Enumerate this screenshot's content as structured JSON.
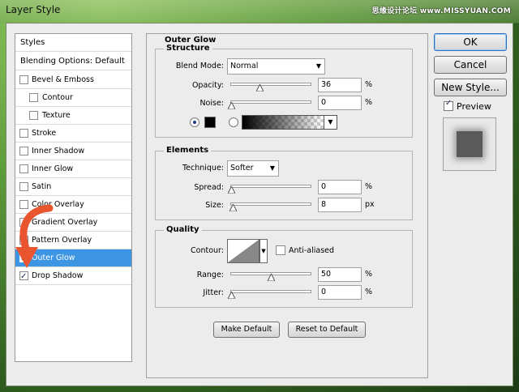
{
  "window": {
    "title": "Layer Style",
    "watermark": "思缘设计论坛 www.MISSYUAN.COM"
  },
  "styles_list": {
    "header": "Styles",
    "blending": "Blending Options: Default",
    "items": [
      {
        "label": "Bevel & Emboss",
        "checked": false,
        "indent": 0
      },
      {
        "label": "Contour",
        "checked": false,
        "indent": 1
      },
      {
        "label": "Texture",
        "checked": false,
        "indent": 1
      },
      {
        "label": "Stroke",
        "checked": false,
        "indent": 0
      },
      {
        "label": "Inner Shadow",
        "checked": false,
        "indent": 0
      },
      {
        "label": "Inner Glow",
        "checked": false,
        "indent": 0
      },
      {
        "label": "Satin",
        "checked": false,
        "indent": 0
      },
      {
        "label": "Color Overlay",
        "checked": false,
        "indent": 0
      },
      {
        "label": "Gradient Overlay",
        "checked": false,
        "indent": 0
      },
      {
        "label": "Pattern Overlay",
        "checked": false,
        "indent": 0
      },
      {
        "label": "Outer Glow",
        "checked": true,
        "indent": 0,
        "selected": true
      },
      {
        "label": "Drop Shadow",
        "checked": true,
        "indent": 0
      }
    ]
  },
  "outer_glow": {
    "title": "Outer Glow",
    "structure": {
      "title": "Structure",
      "blend_mode_label": "Blend Mode:",
      "blend_mode": "Normal",
      "opacity_label": "Opacity:",
      "opacity": "36",
      "opacity_fraction": 0.36,
      "noise_label": "Noise:",
      "noise": "0",
      "noise_fraction": 0.0,
      "percent": "%"
    },
    "elements": {
      "title": "Elements",
      "technique_label": "Technique:",
      "technique": "Softer",
      "spread_label": "Spread:",
      "spread": "0",
      "spread_fraction": 0.0,
      "size_label": "Size:",
      "size": "8",
      "size_fraction": 0.03,
      "percent": "%",
      "px": "px"
    },
    "quality": {
      "title": "Quality",
      "contour_label": "Contour:",
      "anti_aliased": "Anti-aliased",
      "range_label": "Range:",
      "range": "50",
      "range_fraction": 0.5,
      "jitter_label": "Jitter:",
      "jitter": "0",
      "jitter_fraction": 0.0,
      "percent": "%"
    },
    "make_default": "Make Default",
    "reset_default": "Reset to Default"
  },
  "buttons": {
    "ok": "OK",
    "cancel": "Cancel",
    "new_style": "New Style...",
    "preview": "Preview"
  },
  "colors": {
    "selection": "#3d95e3",
    "glow_color": "#000000",
    "arrow": "#e8552f"
  }
}
